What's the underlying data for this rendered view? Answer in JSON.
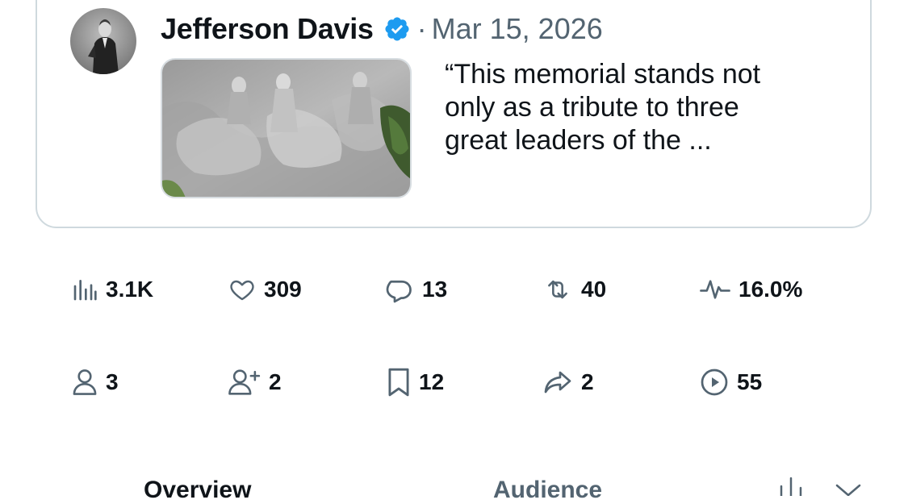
{
  "post_preview": {
    "author_name": "Jefferson Davis",
    "verified": true,
    "separator": "·",
    "date": "Mar 15, 2026",
    "excerpt": "“This memorial stands not only as a tribute to three great leaders of the ..."
  },
  "metrics_row1": [
    {
      "icon": "bar-chart-icon",
      "value": "3.1K"
    },
    {
      "icon": "heart-icon",
      "value": "309"
    },
    {
      "icon": "reply-bubble-icon",
      "value": "13"
    },
    {
      "icon": "repost-icon",
      "value": "40"
    },
    {
      "icon": "activity-pulse-icon",
      "value": "16.0%"
    }
  ],
  "metrics_row2": [
    {
      "icon": "person-icon",
      "value": "3"
    },
    {
      "icon": "person-add-icon",
      "value": "2"
    },
    {
      "icon": "bookmark-icon",
      "value": "12"
    },
    {
      "icon": "share-arrow-icon",
      "value": "2"
    },
    {
      "icon": "play-circle-icon",
      "value": "55"
    }
  ],
  "tabs": [
    {
      "label": "Overview",
      "active": true
    },
    {
      "label": "Audience",
      "active": false
    }
  ],
  "colors": {
    "text": "#0f1419",
    "secondary": "#536471",
    "border": "#cfd9de",
    "verified": "#1d9bf0"
  }
}
